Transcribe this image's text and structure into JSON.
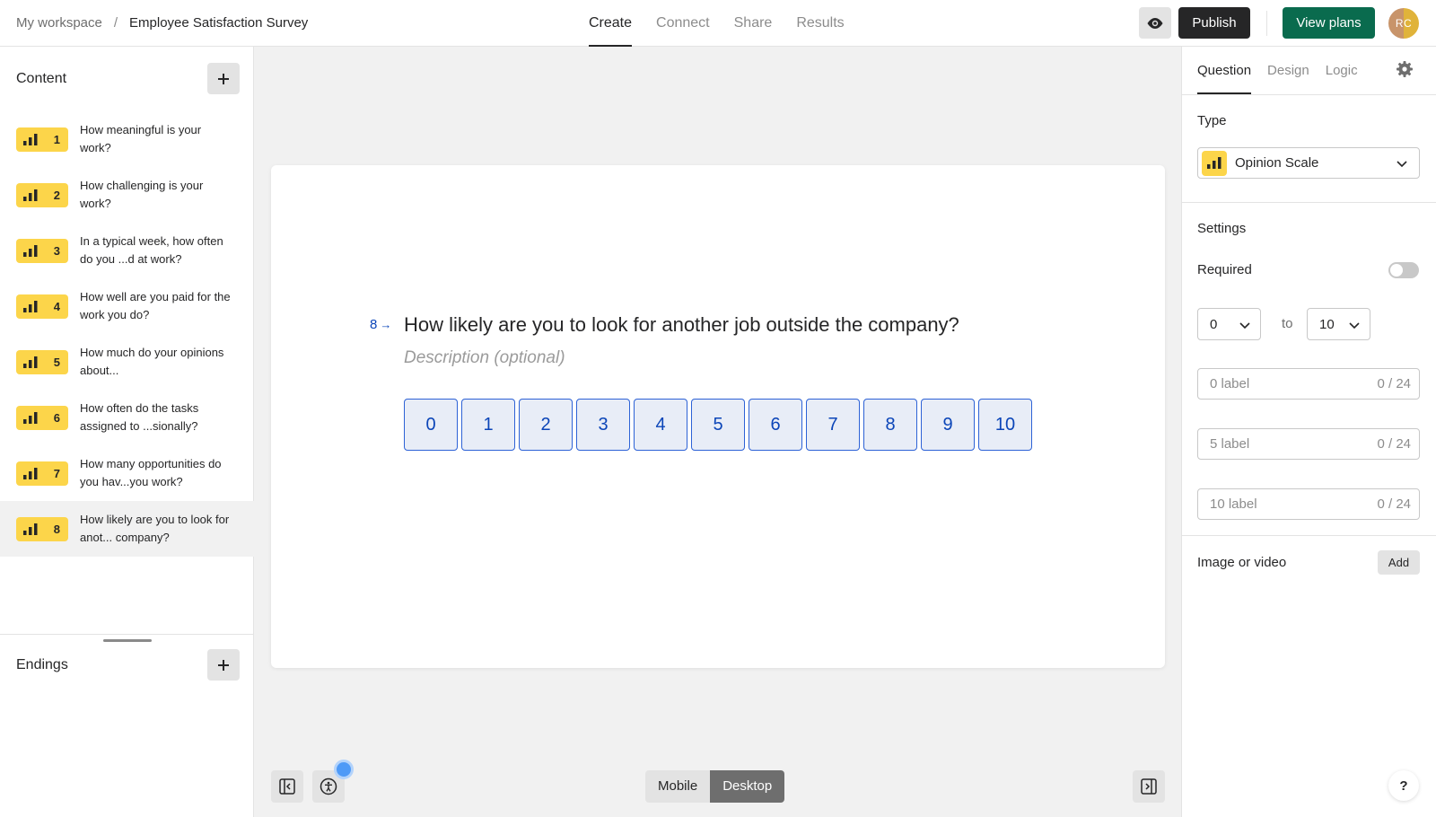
{
  "header": {
    "workspace": "My workspace",
    "separator": "/",
    "form_title": "Employee Satisfaction Survey",
    "tabs": [
      {
        "label": "Create",
        "active": true
      },
      {
        "label": "Connect",
        "active": false
      },
      {
        "label": "Share",
        "active": false
      },
      {
        "label": "Results",
        "active": false
      }
    ],
    "preview_icon": "eye-icon",
    "publish_label": "Publish",
    "view_plans_label": "View plans",
    "avatar_initials": "RC"
  },
  "sidebar": {
    "content_title": "Content",
    "add_icon": "plus-icon",
    "questions": [
      {
        "number": "1",
        "text": "How meaningful is your work?"
      },
      {
        "number": "2",
        "text": "How challenging is your work?"
      },
      {
        "number": "3",
        "text": "In a typical week, how often do you ...d at work?"
      },
      {
        "number": "4",
        "text": "How well are you paid for the work you do?"
      },
      {
        "number": "5",
        "text": "How much do your opinions about..."
      },
      {
        "number": "6",
        "text": "How often do the tasks assigned to ...sionally?"
      },
      {
        "number": "7",
        "text": "How many opportunities do you hav...you work?"
      },
      {
        "number": "8",
        "text": "How likely are you to look for anot... company?"
      }
    ],
    "selected_index": 7,
    "question_icon": "opinion-scale-icon",
    "endings_title": "Endings"
  },
  "canvas": {
    "question_number": "8",
    "question_arrow": "→",
    "question_title": "How likely are you to look for another job outside the company?",
    "description_placeholder": "Description (optional)",
    "scale": [
      "0",
      "1",
      "2",
      "3",
      "4",
      "5",
      "6",
      "7",
      "8",
      "9",
      "10"
    ]
  },
  "bottom": {
    "collapse_left_icon": "collapse-left-panel-icon",
    "accessibility_icon": "accessibility-icon",
    "devices": [
      {
        "label": "Mobile",
        "active": false
      },
      {
        "label": "Desktop",
        "active": true
      }
    ],
    "collapse_right_icon": "collapse-right-panel-icon",
    "help_label": "?"
  },
  "panel": {
    "tabs": [
      {
        "label": "Question",
        "active": true
      },
      {
        "label": "Design",
        "active": false
      },
      {
        "label": "Logic",
        "active": false
      }
    ],
    "settings_icon": "gear-icon",
    "type_label": "Type",
    "type_value": "Opinion Scale",
    "settings_label": "Settings",
    "required_label": "Required",
    "required_on": false,
    "range_from": "0",
    "range_to_text": "to",
    "range_to": "10",
    "label_fields": [
      {
        "placeholder": "0 label",
        "value": "",
        "count": "0 / 24"
      },
      {
        "placeholder": "5 label",
        "value": "",
        "count": "0 / 24"
      },
      {
        "placeholder": "10 label",
        "value": "",
        "count": "0 / 24"
      }
    ],
    "media_label": "Image or video",
    "media_add_label": "Add"
  },
  "colors": {
    "accent_yellow": "#fcd54a",
    "scale_blue": "#0b45b8",
    "view_plans_green": "#0a6b4e",
    "publish_dark": "#262627"
  }
}
